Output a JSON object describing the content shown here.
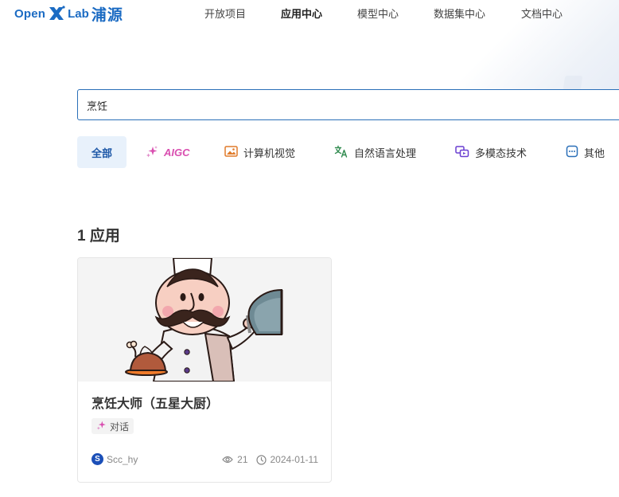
{
  "brand": {
    "open": "Open",
    "lab": "Lab",
    "cn": "浦源"
  },
  "nav": [
    {
      "label": "开放项目"
    },
    {
      "label": "应用中心"
    },
    {
      "label": "模型中心"
    },
    {
      "label": "数据集中心"
    },
    {
      "label": "文档中心"
    }
  ],
  "search": {
    "value": "烹饪"
  },
  "categories": [
    {
      "label": "全部",
      "icon": "none"
    },
    {
      "label": "AIGC",
      "icon": "sparkle-icon"
    },
    {
      "label": "计算机视觉",
      "icon": "image-icon"
    },
    {
      "label": "自然语言处理",
      "icon": "translate-icon"
    },
    {
      "label": "多模态技术",
      "icon": "multimodal-icon"
    },
    {
      "label": "其他",
      "icon": "more-icon"
    }
  ],
  "results": {
    "count": "1",
    "unit": "应用"
  },
  "card": {
    "title": "烹饪大师（五星大厨）",
    "tag": "对话",
    "author_initial": "S",
    "author": "Scc_hy",
    "views": "21",
    "date": "2024-01-11"
  },
  "colors": {
    "brand": "#1b6bc3",
    "accent": "#1b56a6",
    "aigc": "#d94fb0"
  }
}
